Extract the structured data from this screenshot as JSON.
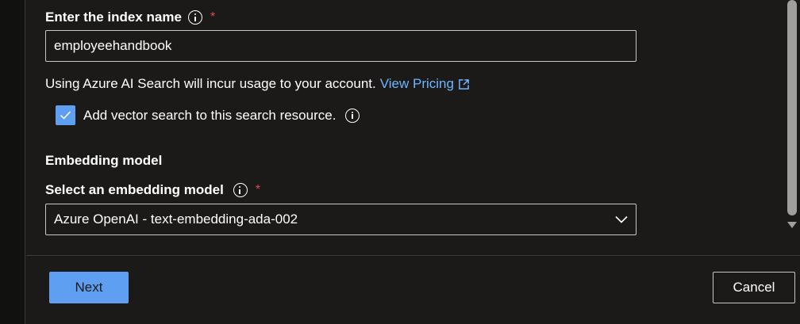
{
  "index": {
    "label": "Enter the index name",
    "required_marker": "*",
    "value": "employeehandbook"
  },
  "usage": {
    "text": "Using Azure AI Search will incur usage to your account.",
    "link_label": "View Pricing"
  },
  "vector_search": {
    "label": "Add vector search to this search resource.",
    "checked": true
  },
  "embedding": {
    "section_title": "Embedding model",
    "select_label": "Select an embedding model",
    "required_marker": "*",
    "selected_value": "Azure OpenAI - text-embedding-ada-002"
  },
  "footer": {
    "next_label": "Next",
    "cancel_label": "Cancel"
  },
  "colors": {
    "background": "#1b1a19",
    "accent": "#5e9ff2",
    "link": "#6cb6ff",
    "required": "#e0474e",
    "border": "#c8c6c4"
  },
  "icons": [
    "info-icon",
    "external-link-icon",
    "checkmark-icon",
    "chevron-down-icon"
  ]
}
